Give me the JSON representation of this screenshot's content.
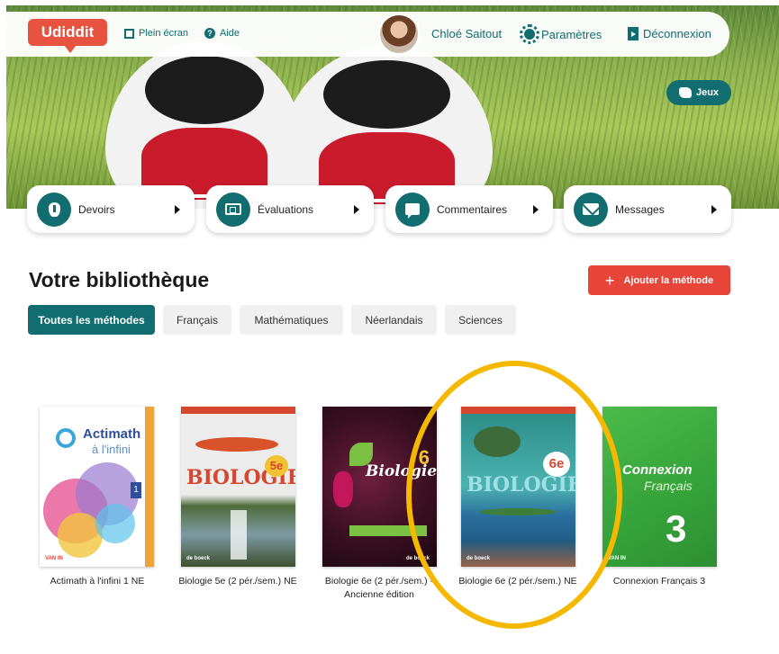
{
  "header": {
    "logo_text": "Udiddit",
    "fullscreen_label": "Plein écran",
    "help_label": "Aide",
    "user_name": "Chloé Saitout",
    "settings_label": "Paramètres",
    "logout_label": "Déconnexion"
  },
  "hero": {
    "games_label": "Jeux"
  },
  "nav": [
    {
      "label": "Devoirs",
      "icon": "drop-icon"
    },
    {
      "label": "Évaluations",
      "icon": "board-icon"
    },
    {
      "label": "Commentaires",
      "icon": "chat-icon"
    },
    {
      "label": "Messages",
      "icon": "mail-icon"
    }
  ],
  "library": {
    "title": "Votre bibliothèque",
    "add_label": "Ajouter la méthode",
    "tabs": [
      "Toutes les méthodes",
      "Français",
      "Mathématiques",
      "Néerlandais",
      "Sciences"
    ],
    "active_tab": 0,
    "books": [
      {
        "title": "Actimath à l'infini 1 NE",
        "cover_text": "Actimath",
        "cover_sub": "à l'infini",
        "cover_num": "1",
        "publisher": "VAN IN"
      },
      {
        "title": "Biologie 5e (2 pér./sem.) NE",
        "cover_text": "BIOLOGIE",
        "cover_num": "5e",
        "publisher": "de boeck"
      },
      {
        "title": "Biologie 6e (2 pér./sem.) - Ancienne édition",
        "cover_text": "Biologie",
        "cover_num": "6",
        "publisher": "de boeck"
      },
      {
        "title": "Biologie 6e (2 pér./sem.) NE",
        "cover_text": "BIOLOGIE",
        "cover_num": "6e",
        "publisher": "de boeck"
      },
      {
        "title": "Connexion Français 3",
        "cover_text": "Connexion",
        "cover_sub": "Français",
        "cover_num": "3",
        "publisher": "VAN IN"
      }
    ]
  },
  "colors": {
    "brand_teal": "#116d6f",
    "logo_orange": "#e8533f",
    "accent_red": "#e8453a",
    "highlight_yellow": "#f5b800"
  }
}
